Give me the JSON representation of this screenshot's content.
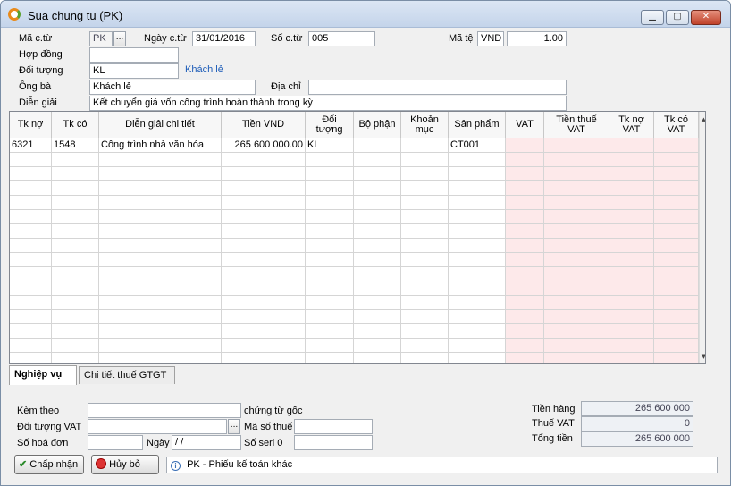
{
  "window": {
    "title": "Sua chung tu (PK)",
    "minimize": "▁",
    "maximize": "▢",
    "close": "✕"
  },
  "header": {
    "ma_ctu_label": "Mã c.từ",
    "ma_ctu_value": "PK",
    "ma_ctu_browse": "...",
    "ngay_ctu_label": "Ngày c.từ",
    "ngay_ctu_value": "31/01/2016",
    "so_ctu_label": "Số c.từ",
    "so_ctu_value": "005",
    "ma_te_label": "Mã tệ",
    "ma_te_value": "VND",
    "ty_gia_value": "1.00",
    "hop_dong_label": "Hợp đồng",
    "hop_dong_value": "",
    "doi_tuong_label": "Đối tượng",
    "doi_tuong_value": "KL",
    "doi_tuong_name": "Khách lẻ",
    "ong_ba_label": "Ông bà",
    "ong_ba_value": "Khách lẻ",
    "dia_chi_label": "Địa chỉ",
    "dia_chi_value": "",
    "dien_giai_label": "Diễn giải",
    "dien_giai_value": "Kết chuyển giá vốn công trình hoàn thành trong kỳ"
  },
  "grid": {
    "columns": [
      "Tk nợ",
      "Tk có",
      "Diễn giải chi tiết",
      "Tiền VND",
      "Đối tượng",
      "Bộ phận",
      "Khoản mục",
      "Sản phẩm",
      "VAT",
      "Tiền thuế VAT",
      "Tk nợ VAT",
      "Tk có VAT"
    ],
    "rows": [
      [
        "6321",
        "1548",
        "Công trình nhà văn hóa",
        "265 600 000.00",
        "KL",
        "",
        "",
        "CT001",
        "",
        "",
        "",
        ""
      ]
    ],
    "scroll_up": "▲",
    "scroll_down": "▼"
  },
  "tabs": [
    {
      "label": "Nghiệp vụ"
    },
    {
      "label": "Chi tiết thuế GTGT"
    }
  ],
  "footer": {
    "kem_theo_label": "Kèm theo",
    "kem_theo_value": "",
    "chung_tu_goc_label": "chứng từ gốc",
    "doi_tuong_vat_label": "Đối tượng VAT",
    "doi_tuong_vat_value": "",
    "doi_tuong_vat_browse": "...",
    "ma_so_thue_label": "Mã số thuế",
    "ma_so_thue_value": "",
    "so_hoa_don_label": "Số hoá đơn",
    "so_hoa_don_value": "",
    "ngay_label": "Ngày",
    "ngay_value": " /  /",
    "so_seri_label": "Số seri 0",
    "so_seri_value": "",
    "tien_hang_label": "Tiền hàng",
    "tien_hang_value": "265 600 000",
    "thue_vat_label": "Thuế VAT",
    "thue_vat_value": "0",
    "tong_tien_label": "Tổng tiền",
    "tong_tien_value": "265 600 000"
  },
  "buttons": {
    "chap_nhan": "Chấp nhận",
    "huy_bo": "Hủy bỏ"
  },
  "status": {
    "text": "PK - Phiếu kế toán khác"
  },
  "colors": {
    "accent": "#1d5cb8",
    "vat_column": "#fde9ea",
    "close_button": "#c0422a"
  }
}
